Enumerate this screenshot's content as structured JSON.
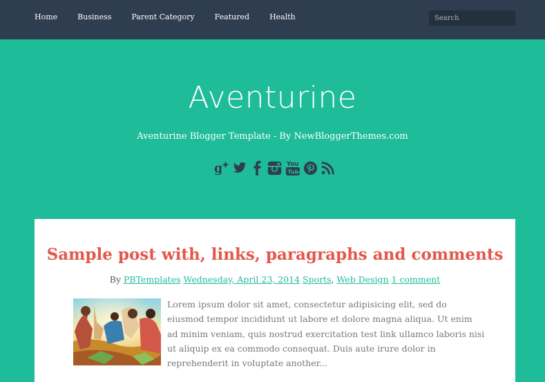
{
  "nav": {
    "items": [
      {
        "label": "Home"
      },
      {
        "label": "Business"
      },
      {
        "label": "Parent Category"
      },
      {
        "label": "Featured"
      },
      {
        "label": "Health"
      }
    ],
    "search_placeholder": "Search"
  },
  "header": {
    "title": "Aventurine",
    "tagline": "Aventurine Blogger Template - By NewBloggerThemes.com",
    "social_icons": [
      "google-plus-icon",
      "twitter-icon",
      "facebook-icon",
      "instagram-icon",
      "youtube-icon",
      "pinterest-icon",
      "rss-icon"
    ]
  },
  "post": {
    "title": "Sample post with, links, paragraphs and comments",
    "meta": {
      "by": "By",
      "author": "PBTemplates",
      "date": "Wednesday, April 23, 2014",
      "category_1": "Sports",
      "separator": ",",
      "category_2": "Web Design",
      "comments": "1 comment"
    },
    "excerpt": "Lorem ipsum dolor sit amet, consectetur adipisicing elit, sed do eiusmod tempor incididunt ut labore et dolore magna aliqua. Ut enim ad minim veniam, quis nostrud exercitation test link ullamco laboris nisi ut aliquip ex ea commodo consequat. Duis aute irure dolor in reprehenderit in voluptate another..."
  },
  "colors": {
    "accent": "#1ebc98",
    "nav_bg": "#2f3d50",
    "title_red": "#e4574a",
    "icon_dark": "#2f3d50"
  }
}
